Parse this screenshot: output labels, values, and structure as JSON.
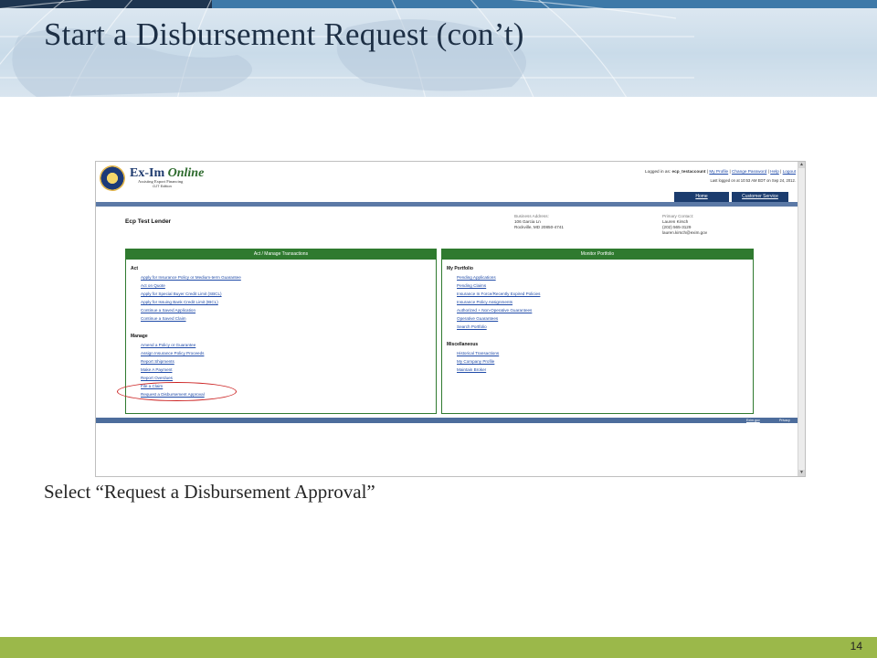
{
  "slide": {
    "title": "Start a Disbursement Request (con’t)",
    "caption": "Select “Request a Disbursement Approval”",
    "page_number": "14",
    "colors": {
      "footer": "#9bb84a",
      "title": "#1d2f45",
      "highlight": "#cc2222"
    }
  },
  "app": {
    "logo": {
      "name": "Ex-Im",
      "name_italic": "Online",
      "tagline": "Assisting Export Financing",
      "edition": "OJT Edition",
      "icon": "ex-im-bank-seal-icon"
    },
    "login": {
      "prefix": "Logged in as:",
      "username": "ecp_testaccount",
      "links": [
        "My Profile",
        "Change Password",
        "Help",
        "Logout"
      ],
      "separator": "|",
      "last_logged": "Last logged on at 10:53 AM EDT on Sep 24, 2012."
    },
    "nav_tabs": [
      "Home",
      "Customer Service"
    ],
    "lender_name": "Ecp Test Lender",
    "business_address": {
      "label": "Business Address:",
      "lines": [
        "106 Garcia Ln",
        "Rockville, MD 20850-4741"
      ]
    },
    "primary_contact": {
      "label": "Primary Contact:",
      "lines": [
        "Lauren Kirsch",
        "(202) 565-3129",
        "lauren.kirsch@exim.gov"
      ]
    },
    "act_panel": {
      "header": "Act / Manage Transactions",
      "sections": [
        {
          "heading": "Act",
          "items": [
            "Apply for Insurance Policy or Medium-term Guarantee",
            "Act on Quote",
            "Apply for Special Buyer Credit Limit (SBCL)",
            "Apply for Issuing Bank Credit Limit (IBCL)",
            "Continue a Saved Application",
            "Continue a Saved Claim"
          ]
        },
        {
          "heading": "Manage",
          "items": [
            "Amend a Policy or Guarantee",
            "Assign Insurance Policy Proceeds",
            "Report Shipments",
            "Make A Payment",
            "Report Overdues",
            "File a Claim",
            "Request a Disbursement Approval"
          ]
        }
      ]
    },
    "portfolio_panel": {
      "header": "Monitor Portfolio",
      "sections": [
        {
          "heading": "My Portfolio",
          "items": [
            "Pending Applications",
            "Pending Claims",
            "Insurance In Force/Recently Expired Policies",
            "Insurance Policy Assignments",
            "Authorized + Non-Operative Guarantees",
            "Operative Guarantees",
            "Search Portfolio"
          ]
        },
        {
          "heading": "Miscellaneous",
          "items": [
            "Historical Transactions",
            "My Company Profile",
            "Maintain Broker"
          ]
        }
      ]
    },
    "footer_links": [
      "Exim.gov",
      "Privacy"
    ],
    "scroll_up_icon": "▲",
    "scroll_down_icon": "▼"
  }
}
